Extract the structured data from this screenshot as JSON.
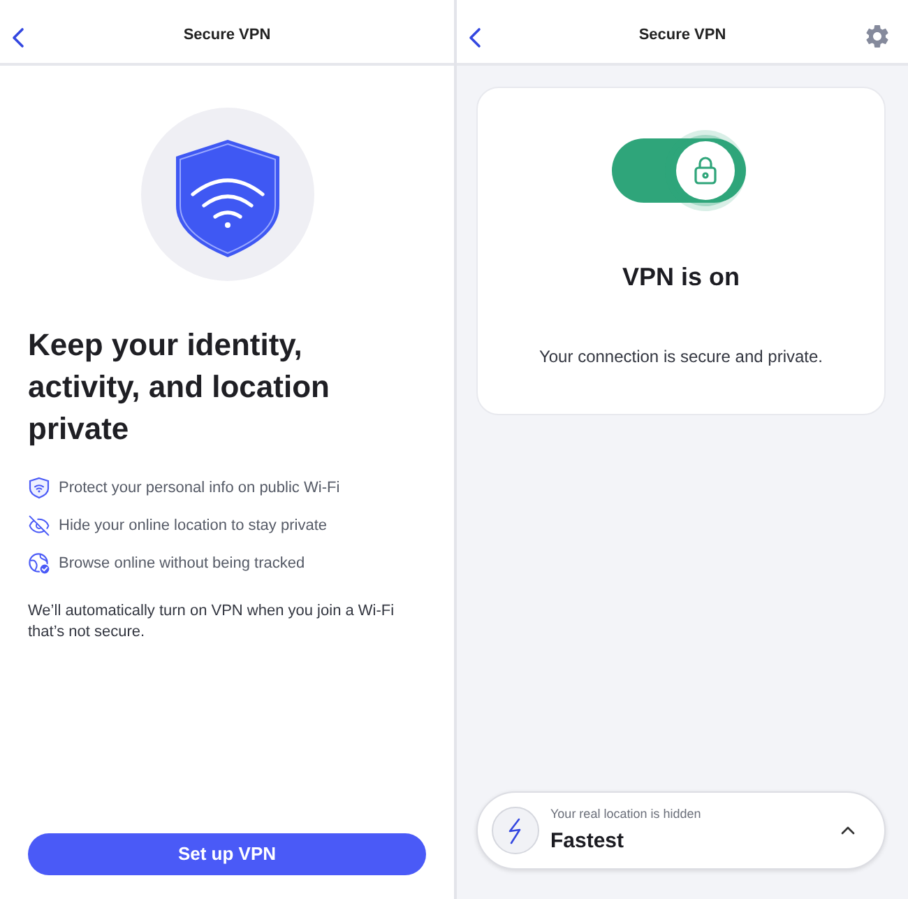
{
  "left_screen": {
    "header": {
      "title": "Secure VPN"
    },
    "heading": "Keep your identity, activity, and location private",
    "features": [
      {
        "kind": "shield-wifi",
        "text": "Protect your personal info on public Wi-Fi"
      },
      {
        "kind": "eye-off",
        "text": "Hide your online location to stay private"
      },
      {
        "kind": "globe-check",
        "text": "Browse online without being tracked"
      }
    ],
    "note": "We’ll automatically turn on VPN when you join a Wi-Fi that’s not secure.",
    "button": "Set up VPN"
  },
  "right_screen": {
    "header": {
      "title": "Secure VPN"
    },
    "vpn_toggle": {
      "on": true
    },
    "status": "VPN is on",
    "message": "Your connection is secure and private.",
    "location_bar": {
      "caption": "Your real location is hidden",
      "server": "Fastest"
    }
  }
}
